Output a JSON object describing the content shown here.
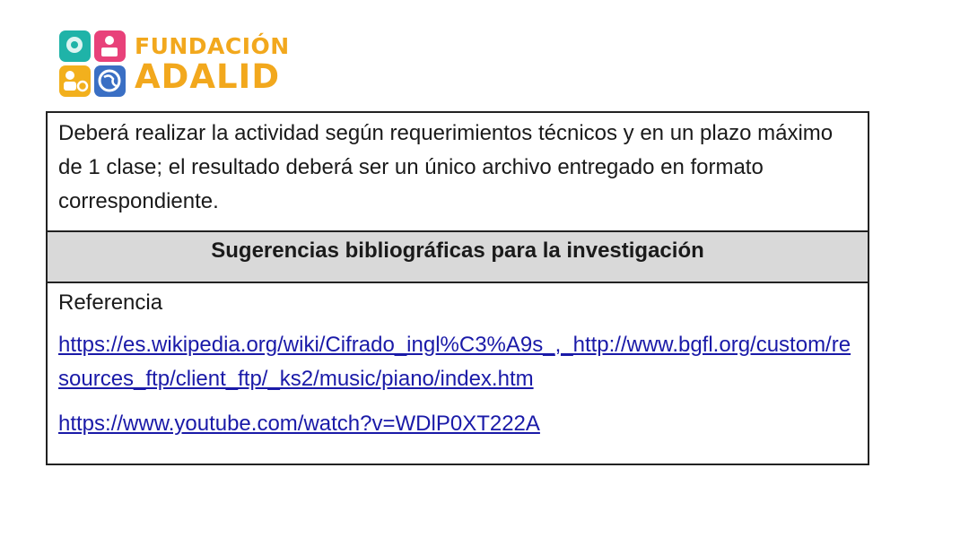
{
  "logo": {
    "line1": "FUNDACIÓN",
    "line2": "ADALID",
    "colors": {
      "text": "#f2a81d",
      "teal": "#1fb3a8",
      "pink": "#e8417a",
      "yellow": "#f2b01d",
      "blue": "#3a6fc4"
    },
    "icons": [
      "head-gear-icon",
      "person-laptop-icon",
      "person-gear-icon",
      "globe-icon"
    ]
  },
  "intro": {
    "text": "Deberá realizar la actividad según requerimientos técnicos y en un plazo máximo de 1 clase; el resultado deberá ser un único archivo entregado en formato correspondiente."
  },
  "section": {
    "header": "Sugerencias bibliográficas para la investigación"
  },
  "references": {
    "label": "Referencia",
    "links": [
      "https://es.wikipedia.org/wiki/Cifrado_ingl%C3%A9s_,_http://www.bgfl.org/custom/resources_ftp/client_ftp/_ks2/music/piano/index.htm",
      "https://www.youtube.com/watch?v=WDlP0XT222A"
    ]
  }
}
